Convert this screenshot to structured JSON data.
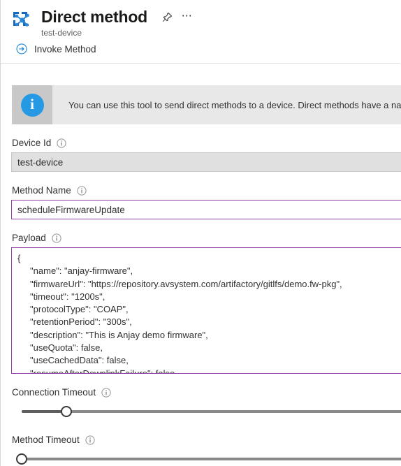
{
  "header": {
    "icon": "iot-device-graph-icon",
    "title": "Direct method",
    "subtitle": "test-device",
    "pin_icon": "pin-icon",
    "more_icon": "ellipsis-icon"
  },
  "commandbar": {
    "invoke": {
      "icon": "arrow-circle-right-icon",
      "label": "Invoke Method"
    }
  },
  "notification": {
    "icon": "info-circle-icon",
    "text": "You can use this tool to send direct methods to a device. Direct methods have a name, payloa"
  },
  "fields": {
    "device_id": {
      "label": "Device Id",
      "info_icon": "info-icon",
      "value": "test-device",
      "disabled": true
    },
    "method_name": {
      "label": "Method Name",
      "info_icon": "info-icon",
      "value": "scheduleFirmwareUpdate",
      "placeholder": ""
    },
    "payload": {
      "label": "Payload",
      "info_icon": "info-icon",
      "value": "{\n     \"name\": \"anjay-firmware\",\n     \"firmwareUrl\": \"https://repository.avsystem.com/artifactory/gitlfs/demo.fw-pkg\",\n     \"timeout\": \"1200s\",\n     \"protocolType\": \"COAP\",\n     \"retentionPeriod\": \"300s\",\n     \"description\": \"This is Anjay demo firmware\",\n     \"useQuota\": false,\n     \"useCachedData\": false,\n     \"resumeAfterDownlinkFailure\": false,"
    },
    "connection_timeout": {
      "label": "Connection Timeout",
      "info_icon": "info-icon",
      "percent": 11
    },
    "method_timeout": {
      "label": "Method Timeout",
      "info_icon": "info-icon",
      "percent": 0
    }
  },
  "colors": {
    "accent_border": "#8a3ea0",
    "info_blue": "#2699e4",
    "brand_blue": "#0078d4",
    "banner_bg": "#e8e8e8",
    "banner_icon_bg": "#c8c8c8"
  }
}
